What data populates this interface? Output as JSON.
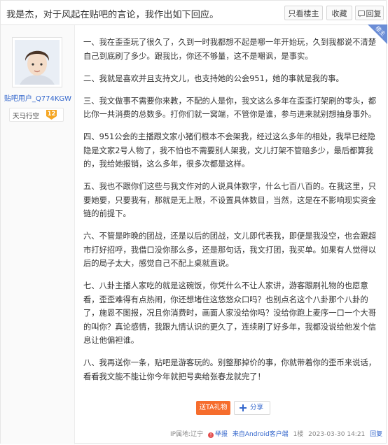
{
  "thread": {
    "title": "我是杰，对于风起在贴吧的言论，我作出如下回应。",
    "only_author_label": "只看楼主",
    "favorite_label": "收藏",
    "reply_label": "回复"
  },
  "author": {
    "username": "贴吧用户_Q774KGW",
    "rank_name": "天马行空",
    "level": "12",
    "badge_text": "楼主"
  },
  "post": {
    "paragraphs": [
      "一、我在歪歪玩了很久了，久到一时我都想不起是哪一年开始玩，久到我都说不清楚自己到底刷了多少。跟我比，你还不够量，这不是嘲讽，是事实。",
      "二、我就是喜欢并且支持文儿，也支持她的公会951，她的事就是我的事。",
      "三、我文做事不需要你来教，不配的人是你，我文这么多年在歪歪打架刷的零头，都比你一共消费的总数多。打你们就一窝端，不管你是谁，参与进来就别想抽身事外。",
      "四、951公会的主播跟文家小猪们根本不会架我，经过这么多年的相处，我早已经隐隐是文家2号人物了，我不怕也不需要别人架我，文儿打架不管赔多少，最后都算我的，我给她报销，这么多年，很多次都是这样。",
      "五、我也不跟你们这些与我文作对的人说具体数字，什么七百八百的。在我这里，只要她要，只要我有，那就是无上限，不设置具体数目，当然，这是在不影响现实资金链的前提下。",
      "六、不管是昨晚的团战，还是以后的团战，文儿即代表我，即便是我没空，也会跟超市打好招呼，我借口没你那么多，还是那句话，我文打团，我买单。如果有人觉得以后的局子太大，感觉自己不配上桌就直说。",
      "七、八卦主播人家吃的就是这碗饭，你凭什么不让人家讲，游客跟刷礼物的也愿意看，歪歪难得有点热闹，你还想堵住这悠悠众口吗？也别点名这个八卦那个八卦的了，施恩不图报，况且你消费时，画面人家没给你吗？没给你跑上麦序一口一个大哥的叫你？真论感情，我跟九情认识的更久了，连续刷了好多年，我都没说给他发个信息让他偏袒谁。",
      "八、我再送你一条，贴吧是游客玩的。别整那掉价的事，你就带着你的歪币来说话，看看我文能不能让你今年就把号卖给张春龙就完了！"
    ]
  },
  "actions": {
    "gift_label": "送TA礼物",
    "share_label": "分享"
  },
  "footer": {
    "ip_location": "IP属地:辽宁",
    "report_label": "举报",
    "client": "来自Android客户端",
    "floor": "1楼",
    "timestamp": "2023-03-30 14:21",
    "reply_label": "回复"
  },
  "colors": {
    "link": "#3366cc",
    "gift_button": "#f66d2d",
    "badge": "#6b8dd6",
    "level_badge": "#f5a623"
  }
}
